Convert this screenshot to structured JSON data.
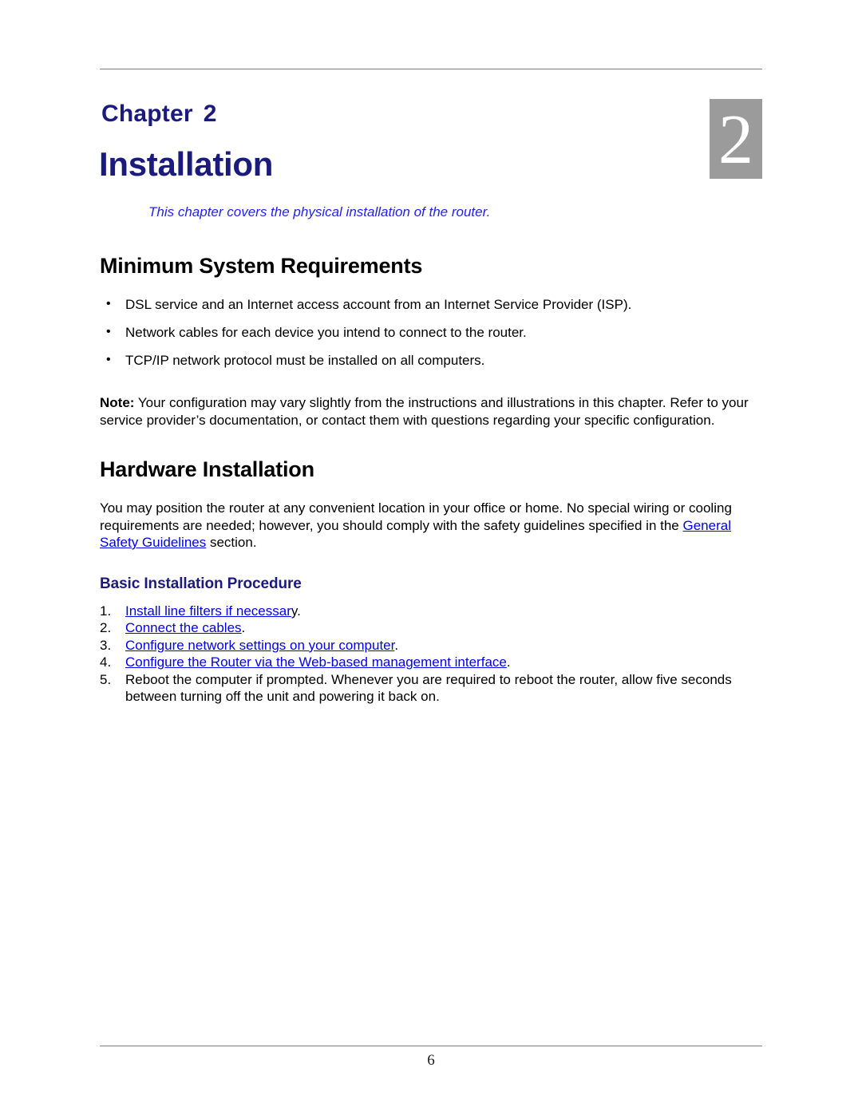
{
  "document": {
    "chapter_label": "Chapter",
    "chapter_number": "2",
    "chapter_title": "Installation",
    "chapter_badge_number": "2",
    "chapter_subtitle": "This chapter covers the physical installation of the router.",
    "page_number": "6",
    "colors": {
      "heading_navy": "#1b1b7e",
      "subtitle_blue": "#2222ee",
      "link_blue": "#0000ee",
      "badge_gray": "#9b9b9b",
      "rule_gray": "#7d7d7d"
    }
  },
  "sections": {
    "minimum_system_requirements": {
      "heading": "Minimum System Requirements",
      "bullets": [
        "DSL service and an Internet access account from an Internet Service Provider (ISP).",
        "Network cables for each device you intend to connect to the router.",
        "TCP/IP network protocol must be installed on all computers."
      ],
      "note": {
        "label": "Note:",
        "text": " Your configuration may vary slightly from the instructions and illustrations in this chapter. Refer to your service provider’s documentation, or contact them with questions regarding your specific configuration."
      }
    },
    "hardware_installation": {
      "heading": "Hardware Installation",
      "paragraph_before_link": "You may position the router at any convenient location in your office or home. No special wiring or cooling requirements are needed; however, you should comply with the safety guidelines specified in the ",
      "paragraph_link": "General Safety Guidelines",
      "paragraph_after_link": " section.",
      "sub_heading": "Basic Installation Procedure",
      "steps": [
        {
          "number": "1.",
          "link": "Install line filters if necessar",
          "plain_after": "y."
        },
        {
          "number": "2.",
          "link": "Connect the cables",
          "plain_after": "."
        },
        {
          "number": "3.",
          "link": "Configure network settings on your computer",
          "plain_after": "."
        },
        {
          "number": "4.",
          "link": "Configure the Router via the Web-based management interface",
          "plain_after": "."
        },
        {
          "number": "5.",
          "link": "",
          "plain_after": "Reboot the computer if prompted. Whenever you are required to reboot the router, allow five seconds between turning off the unit and powering it back on."
        }
      ]
    }
  }
}
